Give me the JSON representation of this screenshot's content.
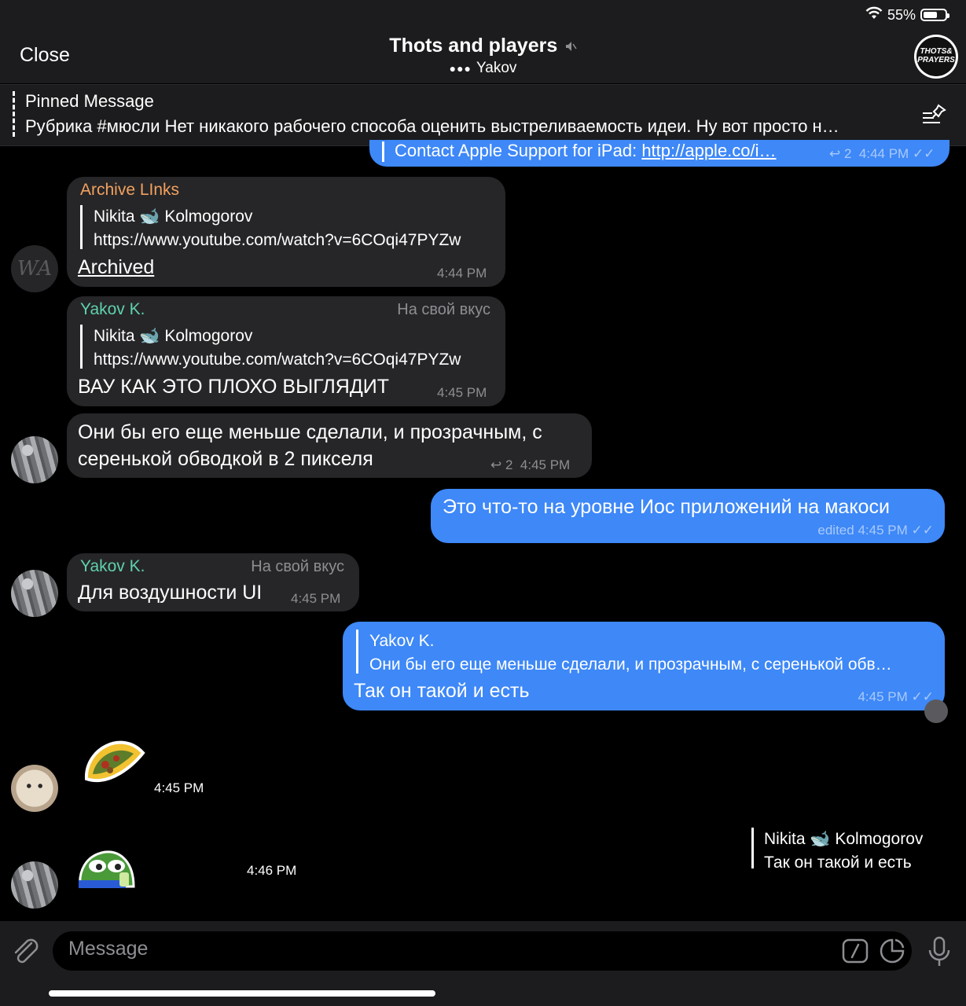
{
  "status": {
    "battery": "55%",
    "battery_level": 0.55
  },
  "header": {
    "close_label": "Close",
    "chat_title": "Thots and players",
    "typing_name": "Yakov",
    "avatar_text_1": "THOTS&",
    "avatar_text_2": "PRAYERS"
  },
  "pinned": {
    "title": "Pinned Message",
    "text": "Рубрика #мюсли Нет никакого рабочего способа оценить выстреливаемость идеи. Ну вот просто н…"
  },
  "messages": {
    "m0": {
      "text": "Contact Apple Support for iPad: ",
      "link": "http://apple.co/i…",
      "replies": "2",
      "time": "4:44 PM"
    },
    "m1": {
      "sender": "Archive LInks",
      "quote_name": "Nikita 🐋 Kolmogorov",
      "quote_text": "https://www.youtube.com/watch?v=6COqi47PYZw",
      "text": "Archived",
      "time": "4:44 PM",
      "avatar": "WA"
    },
    "m2": {
      "sender": "Yakov K.",
      "rank": "На свой вкус",
      "quote_name": "Nikita 🐋 Kolmogorov",
      "quote_text": "https://www.youtube.com/watch?v=6COqi47PYZw",
      "text": "ВАУ КАК ЭТО ПЛОХО ВЫГЛЯДИТ",
      "time": "4:45 PM"
    },
    "m3": {
      "line1": "Они бы его еще меньше сделали, и прозрачным, с",
      "line2": "серенькой обводкой в 2 пикселя",
      "replies": "2",
      "time": "4:45 PM"
    },
    "m4": {
      "text": "Это что-то на уровне Иос приложений на макоси",
      "status": "edited",
      "time": "4:45 PM"
    },
    "m5": {
      "sender": "Yakov K.",
      "rank": "На свой вкус",
      "text": "Для воздушности UI",
      "time": "4:45 PM"
    },
    "m6": {
      "quote_name": "Yakov K.",
      "quote_text": "Они бы его еще меньше сделали, и прозрачным, с серенькой обв…",
      "text": "Так он такой и есть",
      "time": "4:45 PM"
    },
    "m7": {
      "sticker": "taco-sticker",
      "time": "4:45 PM"
    },
    "m8": {
      "sticker": "pepe-sticker",
      "time": "4:46 PM",
      "reply_name": "Nikita 🐋 Kolmogorov",
      "reply_text": "Так он такой и есть"
    }
  },
  "input": {
    "placeholder": "Message"
  },
  "colors": {
    "accent": "#3e88f7",
    "incoming": "#262628",
    "sender_orange": "#f3a15f",
    "sender_teal": "#5fd1ae"
  }
}
